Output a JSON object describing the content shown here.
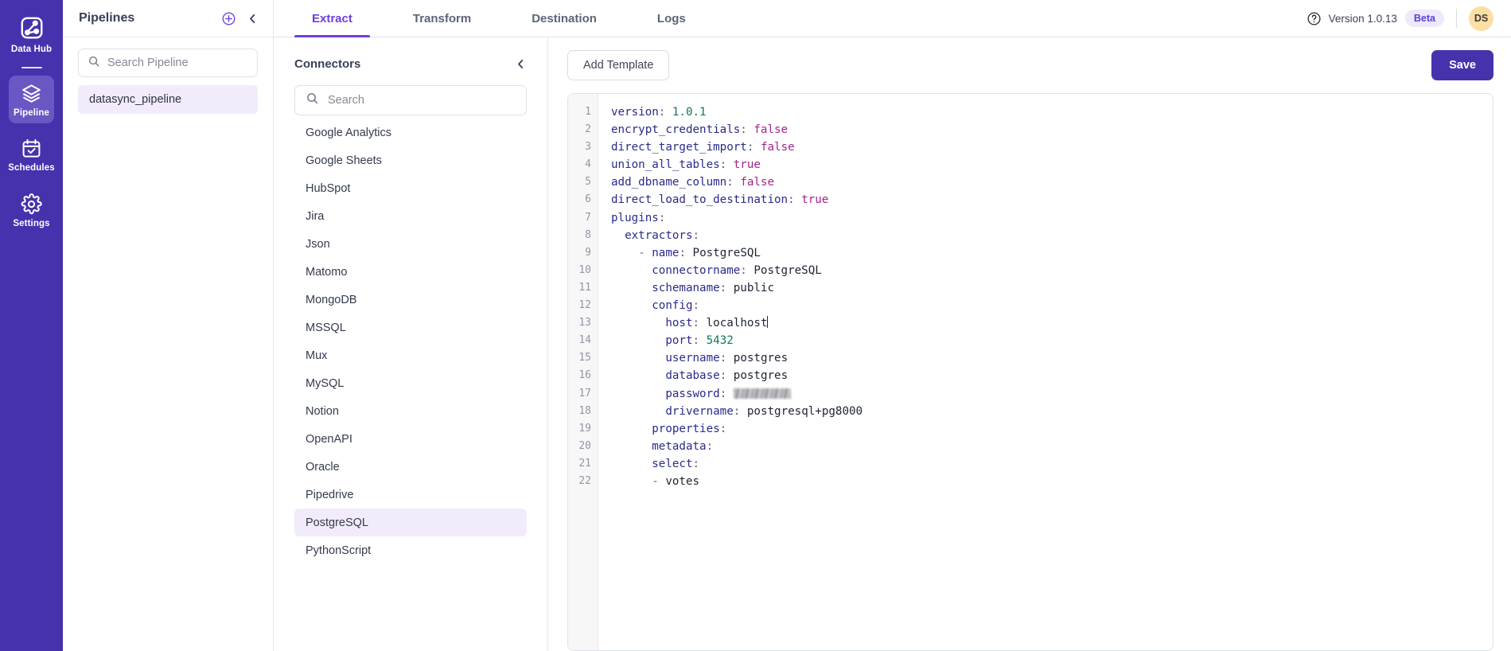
{
  "rail": {
    "logo": {
      "label": "Data Hub",
      "icon": "data-hub-logo-icon"
    },
    "items": [
      {
        "label": "Pipeline",
        "icon": "layers-icon",
        "active": true
      },
      {
        "label": "Schedules",
        "icon": "calendar-check-icon",
        "active": false
      },
      {
        "label": "Settings",
        "icon": "gear-icon",
        "active": false
      }
    ]
  },
  "pipelines": {
    "title": "Pipelines",
    "add_icon": "plus-circle-icon",
    "collapse_icon": "chevron-left-icon",
    "search": {
      "value": "",
      "placeholder": "Search Pipeline",
      "icon": "search-icon"
    },
    "items": [
      {
        "label": "datasync_pipeline",
        "selected": true
      }
    ]
  },
  "topbar": {
    "tabs": [
      {
        "label": "Extract",
        "active": true
      },
      {
        "label": "Transform",
        "active": false
      },
      {
        "label": "Destination",
        "active": false
      },
      {
        "label": "Logs",
        "active": false
      }
    ],
    "help_icon": "help-circle-icon",
    "version": "Version 1.0.13",
    "badge": "Beta",
    "avatar": "DS"
  },
  "connectors": {
    "title": "Connectors",
    "collapse_icon": "chevron-left-icon",
    "search": {
      "value": "",
      "placeholder": "Search",
      "icon": "search-icon"
    },
    "items": [
      {
        "label": "Google Analytics",
        "selected": false
      },
      {
        "label": "Google Sheets",
        "selected": false
      },
      {
        "label": "HubSpot",
        "selected": false
      },
      {
        "label": "Jira",
        "selected": false
      },
      {
        "label": "Json",
        "selected": false
      },
      {
        "label": "Matomo",
        "selected": false
      },
      {
        "label": "MongoDB",
        "selected": false
      },
      {
        "label": "MSSQL",
        "selected": false
      },
      {
        "label": "Mux",
        "selected": false
      },
      {
        "label": "MySQL",
        "selected": false
      },
      {
        "label": "Notion",
        "selected": false
      },
      {
        "label": "OpenAPI",
        "selected": false
      },
      {
        "label": "Oracle",
        "selected": false
      },
      {
        "label": "Pipedrive",
        "selected": false
      },
      {
        "label": "PostgreSQL",
        "selected": true
      },
      {
        "label": "PythonScript",
        "selected": false
      }
    ]
  },
  "editor": {
    "add_template_label": "Add Template",
    "save_label": "Save",
    "line_numbers": [
      1,
      2,
      3,
      4,
      5,
      6,
      7,
      8,
      9,
      10,
      11,
      12,
      13,
      14,
      15,
      16,
      17,
      18,
      19,
      20,
      21,
      22
    ],
    "lines": [
      {
        "n": 1,
        "indent": 0,
        "key": "version",
        "value": "1.0.1",
        "vtype": "num"
      },
      {
        "n": 2,
        "indent": 0,
        "key": "encrypt_credentials",
        "value": "false",
        "vtype": "bool"
      },
      {
        "n": 3,
        "indent": 0,
        "key": "direct_target_import",
        "value": "false",
        "vtype": "bool"
      },
      {
        "n": 4,
        "indent": 0,
        "key": "union_all_tables",
        "value": "true",
        "vtype": "bool"
      },
      {
        "n": 5,
        "indent": 0,
        "key": "add_dbname_column",
        "value": "false",
        "vtype": "bool"
      },
      {
        "n": 6,
        "indent": 0,
        "key": "direct_load_to_destination",
        "value": "true",
        "vtype": "bool"
      },
      {
        "n": 7,
        "indent": 0,
        "key": "plugins",
        "value": "",
        "vtype": "none"
      },
      {
        "n": 8,
        "indent": 1,
        "key": "extractors",
        "value": "",
        "vtype": "none"
      },
      {
        "n": 9,
        "indent": 2,
        "dash": true,
        "key": "name",
        "value": "PostgreSQL",
        "vtype": "str"
      },
      {
        "n": 10,
        "indent": 3,
        "key": "connectorname",
        "value": "PostgreSQL",
        "vtype": "str"
      },
      {
        "n": 11,
        "indent": 3,
        "key": "schemaname",
        "value": "public",
        "vtype": "str"
      },
      {
        "n": 12,
        "indent": 3,
        "key": "config",
        "value": "",
        "vtype": "none"
      },
      {
        "n": 13,
        "indent": 4,
        "key": "host",
        "value": "localhost",
        "vtype": "str",
        "caret": true
      },
      {
        "n": 14,
        "indent": 4,
        "key": "port",
        "value": "5432",
        "vtype": "num"
      },
      {
        "n": 15,
        "indent": 4,
        "key": "username",
        "value": "postgres",
        "vtype": "str"
      },
      {
        "n": 16,
        "indent": 4,
        "key": "database",
        "value": "postgres",
        "vtype": "str"
      },
      {
        "n": 17,
        "indent": 4,
        "key": "password",
        "value": "",
        "vtype": "redacted"
      },
      {
        "n": 18,
        "indent": 4,
        "key": "drivername",
        "value": "postgresql+pg8000",
        "vtype": "str"
      },
      {
        "n": 19,
        "indent": 3,
        "key": "properties",
        "value": "",
        "vtype": "none"
      },
      {
        "n": 20,
        "indent": 3,
        "key": "metadata",
        "value": "",
        "vtype": "none"
      },
      {
        "n": 21,
        "indent": 3,
        "key": "select",
        "value": "",
        "vtype": "none"
      },
      {
        "n": 22,
        "indent": 3,
        "dash": true,
        "key": "",
        "value": "votes",
        "vtype": "item"
      }
    ]
  },
  "colors": {
    "rail_bg": "#4632ac",
    "rail_active": "#6a57c4",
    "accent": "#6d3fe0",
    "selected_bg": "#f2ebfb",
    "avatar_bg": "#fcdfa4",
    "yaml_key": "#2a2a8a",
    "yaml_bool": "#a3228e",
    "yaml_num": "#0f7b52"
  }
}
